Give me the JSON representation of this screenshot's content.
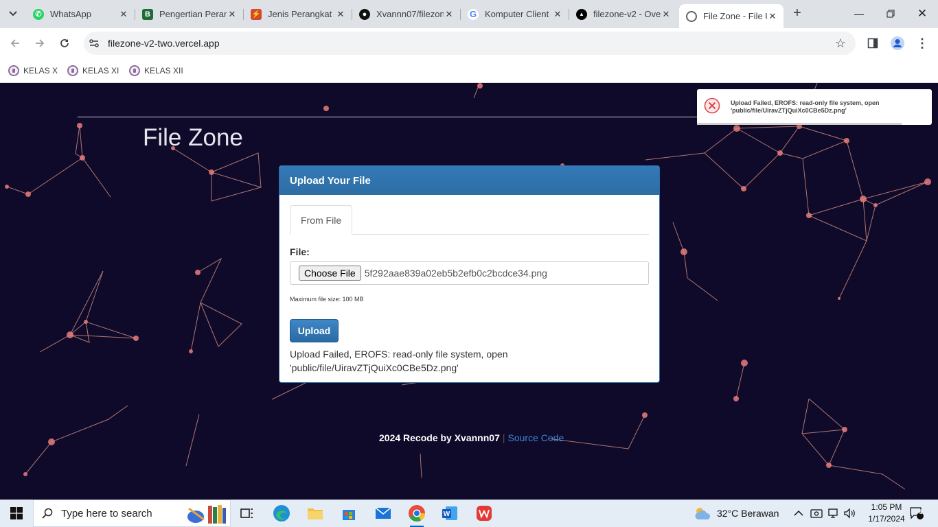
{
  "browser": {
    "tabs": [
      {
        "title": "WhatsApp",
        "icon": "whatsapp-icon",
        "color": "#25d366"
      },
      {
        "title": "Pengertian Peran",
        "icon": "blogger-b-icon",
        "color": "#1f6b3a"
      },
      {
        "title": "Jenis Perangkat",
        "icon": "site-logo-icon",
        "color": "#d24a2a"
      },
      {
        "title": "Xvannn07/filezone",
        "icon": "github-icon",
        "color": "#111111"
      },
      {
        "title": "Komputer Client",
        "icon": "google-icon",
        "color": "#4285f4"
      },
      {
        "title": "filezone-v2 - Ove",
        "icon": "vercel-icon",
        "color": "#000000"
      },
      {
        "title": "File Zone - File U",
        "icon": "globe-icon",
        "color": "#5f6368"
      }
    ],
    "url": "filezone-v2-two.vercel.app",
    "bookmarks": [
      "KELAS X",
      "KELAS XI",
      "KELAS XII"
    ]
  },
  "page": {
    "brand": "File Zone",
    "panel": {
      "heading": "Upload Your File",
      "tab": "From File",
      "file_label": "File:",
      "choose_button": "Choose File",
      "selected_file": "5f292aae839a02eb5b2efb0c2bcdce34.png",
      "help": "Maximum file size: 100 MB",
      "upload_button": "Upload",
      "message": "Upload Failed, EROFS: read-only file system, open 'public/file/UiravZTjQuiXc0CBe5Dz.png'"
    },
    "footer": {
      "credit": "2024 Recode by Xvannn07",
      "separator": "|",
      "link": "Source Code"
    },
    "toast": {
      "text": "Upload Failed, EROFS: read-only file system, open 'public/file/UiravZTjQuiXc0CBe5Dz.png'",
      "progress": 0.87
    }
  },
  "taskbar": {
    "search_placeholder": "Type here to search",
    "weather": "32°C  Berawan",
    "time": "1:05 PM",
    "date": "1/17/2024",
    "notification_count": "1"
  },
  "colors": {
    "page_bg": "#0f0a2a",
    "primary": "#337ab7",
    "link": "#3b84d6",
    "error": "#e0474c"
  }
}
